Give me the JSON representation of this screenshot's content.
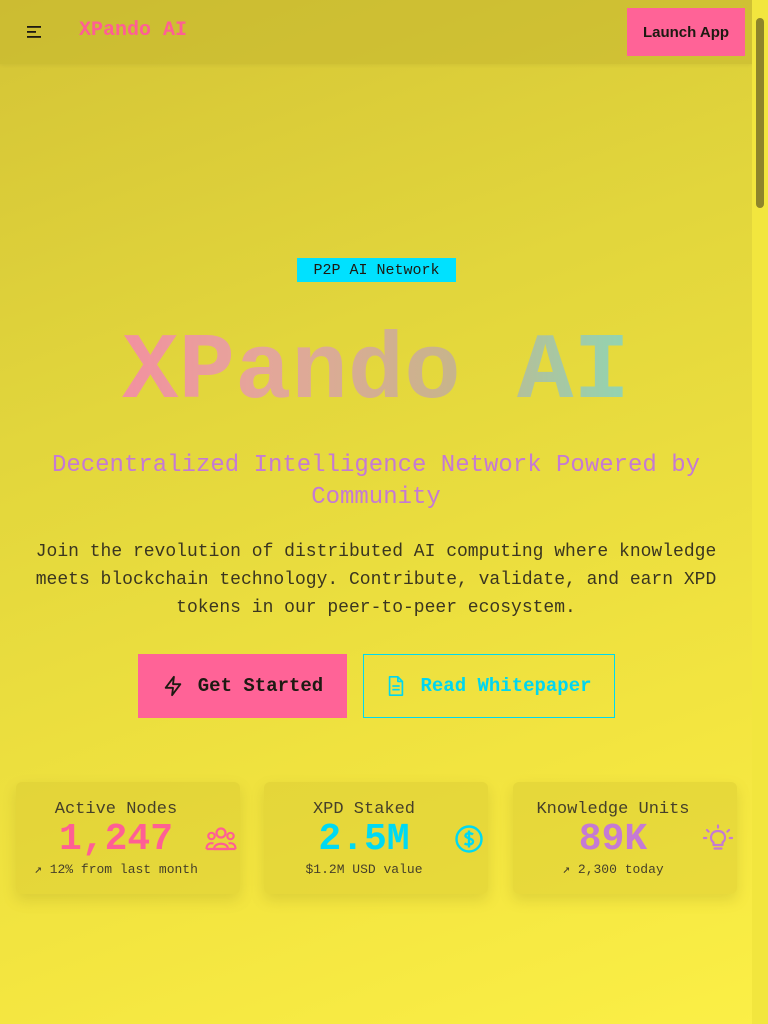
{
  "header": {
    "brand": "XPando AI",
    "launch_label": "Launch App",
    "menu_icon": "hamburger-menu-icon"
  },
  "hero": {
    "badge": "P2P AI Network",
    "title": "XPando AI",
    "subtitle": "Decentralized Intelligence Network Powered by Community",
    "description": "Join the revolution of distributed AI computing where knowledge meets blockchain technology. Contribute, validate, and earn XPD tokens in our peer-to-peer ecosystem.",
    "primary_cta": "Get Started",
    "primary_icon": "lightning-bolt-icon",
    "secondary_cta": "Read Whitepaper",
    "secondary_icon": "document-icon"
  },
  "stats": [
    {
      "label": "Active Nodes",
      "value": "1,247",
      "sub": "↗ 12% from last month",
      "icon": "users-group-icon",
      "color": "#ff5f94"
    },
    {
      "label": "XPD Staked",
      "value": "2.5M",
      "sub": "$1.2M USD value",
      "icon": "dollar-coin-icon",
      "color": "#00d9f2"
    },
    {
      "label": "Knowledge Units",
      "value": "89K",
      "sub": "↗ 2,300 today",
      "icon": "lightbulb-icon",
      "color": "#c57ad4"
    }
  ],
  "colors": {
    "accent_pink": "#ff6397",
    "accent_cyan": "#00e1ff",
    "accent_purple": "#c57ad4"
  }
}
